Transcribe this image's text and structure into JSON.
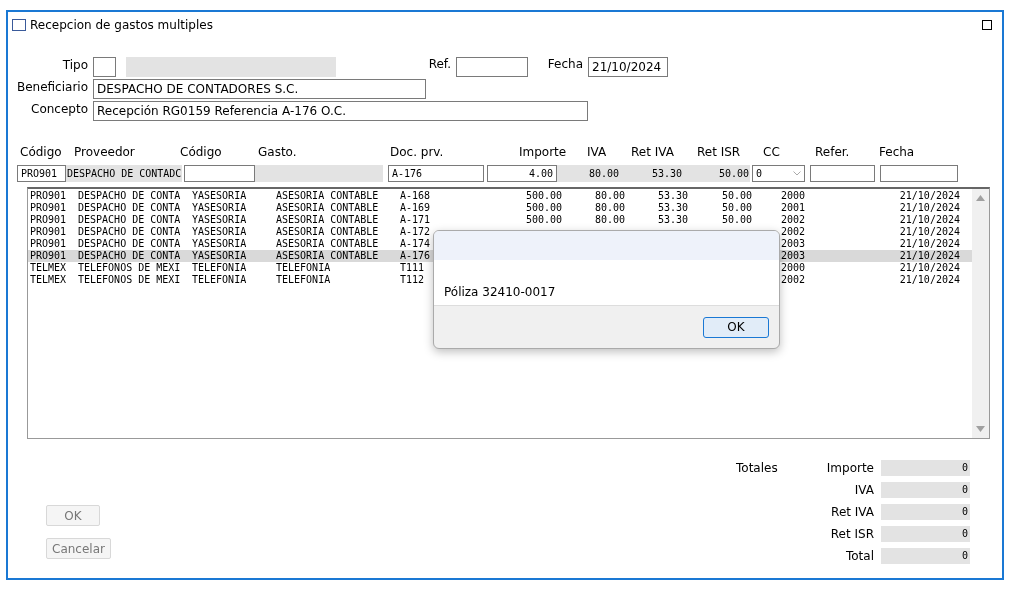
{
  "window": {
    "title": "Recepcion de gastos multiples"
  },
  "form": {
    "tipo": {
      "label": "Tipo"
    },
    "ref": {
      "label": "Ref."
    },
    "fecha": {
      "label": "Fecha",
      "value": "21/10/2024"
    },
    "beneficiario": {
      "label": "Beneficiario",
      "value": "DESPACHO DE CONTADORES S.C."
    },
    "concepto": {
      "label": "Concepto",
      "value": "Recepción RG0159   Referencia A-176 O.C."
    }
  },
  "columns": [
    "Código",
    "Proveedor",
    "Código",
    "Gasto.",
    "Doc. prv.",
    "Importe",
    "IVA",
    "Ret IVA",
    "Ret ISR",
    "CC",
    "Refer.",
    "Fecha"
  ],
  "entry": [
    {
      "kind": "input",
      "value": "PRO901"
    },
    {
      "kind": "readonly",
      "value": "DESPACHO DE CONTADC"
    },
    {
      "kind": "input"
    },
    {
      "kind": "readonly"
    },
    {
      "kind": "input",
      "value": "A-176"
    },
    {
      "kind": "input",
      "value": "4.00"
    },
    {
      "kind": "readonly",
      "value": "80.00"
    },
    {
      "kind": "readonly",
      "value": "53.30"
    },
    {
      "kind": "readonly",
      "value": "50.00"
    },
    {
      "kind": "select",
      "value": "0"
    },
    {
      "kind": "input"
    },
    {
      "kind": "input"
    }
  ],
  "rows": [
    {
      "selected": false,
      "codigo": "PRO901",
      "proveedor": "DESPACHO DE CONTA",
      "codigo_gasto": "YASESORIA",
      "gasto": "ASESORIA CONTABLE",
      "doc": "A-168",
      "importe": "500.00",
      "iva": "80.00",
      "ret_iva": "53.30",
      "ret_isr": "50.00",
      "cc": "2000",
      "fecha": "21/10/2024"
    },
    {
      "selected": false,
      "codigo": "PRO901",
      "proveedor": "DESPACHO DE CONTA",
      "codigo_gasto": "YASESORIA",
      "gasto": "ASESORIA CONTABLE",
      "doc": "A-169",
      "importe": "500.00",
      "iva": "80.00",
      "ret_iva": "53.30",
      "ret_isr": "50.00",
      "cc": "2001",
      "fecha": "21/10/2024"
    },
    {
      "selected": false,
      "codigo": "PRO901",
      "proveedor": "DESPACHO DE CONTA",
      "codigo_gasto": "YASESORIA",
      "gasto": "ASESORIA CONTABLE",
      "doc": "A-171",
      "importe": "500.00",
      "iva": "80.00",
      "ret_iva": "53.30",
      "ret_isr": "50.00",
      "cc": "2002",
      "fecha": "21/10/2024"
    },
    {
      "selected": false,
      "codigo": "PRO901",
      "proveedor": "DESPACHO DE CONTA",
      "codigo_gasto": "YASESORIA",
      "gasto": "ASESORIA CONTABLE",
      "doc": "A-172",
      "cc": "2002",
      "fecha": "21/10/2024"
    },
    {
      "selected": false,
      "codigo": "PRO901",
      "proveedor": "DESPACHO DE CONTA",
      "codigo_gasto": "YASESORIA",
      "gasto": "ASESORIA CONTABLE",
      "doc": "A-174",
      "cc": "2003",
      "fecha": "21/10/2024"
    },
    {
      "selected": true,
      "codigo": "PRO901",
      "proveedor": "DESPACHO DE CONTA",
      "codigo_gasto": "YASESORIA",
      "gasto": "ASESORIA CONTABLE",
      "doc": "A-176",
      "cc": "2003",
      "fecha": "21/10/2024"
    },
    {
      "selected": false,
      "codigo": "TELMEX",
      "proveedor": "TELEFONOS DE MEXI",
      "codigo_gasto": "TELEFONIA",
      "gasto": "TELEFONIA",
      "doc": "T111",
      "cc": "2000",
      "fecha": "21/10/2024"
    },
    {
      "selected": false,
      "codigo": "TELMEX",
      "proveedor": "TELEFONOS DE MEXI",
      "codigo_gasto": "TELEFONIA",
      "gasto": "TELEFONIA",
      "doc": "T112",
      "cc": "2002",
      "fecha": "21/10/2024"
    }
  ],
  "dialog": {
    "message": "Póliza 32410-0017",
    "button": "OK"
  },
  "buttons": [
    {
      "label": "OK",
      "disabled": true
    },
    {
      "label": "Cancelar",
      "disabled": true
    }
  ],
  "totals": {
    "title": "Totales",
    "items": [
      {
        "label": "Importe",
        "value": "0"
      },
      {
        "label": "IVA",
        "value": "0"
      },
      {
        "label": "Ret IVA",
        "value": "0"
      },
      {
        "label": "Ret ISR",
        "value": "0"
      },
      {
        "label": "Total",
        "value": "0"
      }
    ]
  }
}
